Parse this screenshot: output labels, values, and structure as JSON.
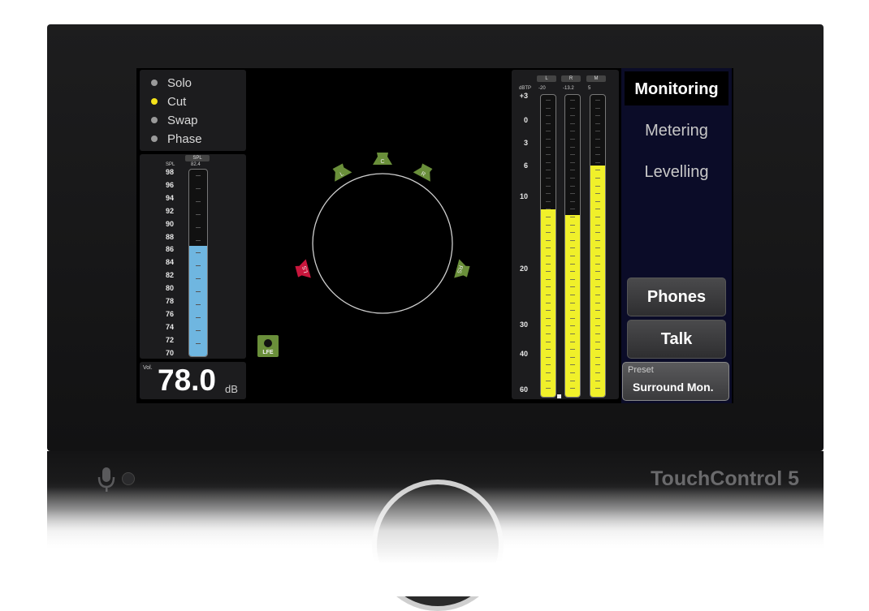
{
  "options": [
    {
      "label": "Solo",
      "active": false
    },
    {
      "label": "Cut",
      "active": true
    },
    {
      "label": "Swap",
      "active": false
    },
    {
      "label": "Phase",
      "active": false
    }
  ],
  "spl_meter": {
    "header": "SPL",
    "axis_label": "SPL",
    "readout": "82.4",
    "ticks": [
      "98",
      "96",
      "94",
      "92",
      "90",
      "88",
      "86",
      "84",
      "82",
      "80",
      "78",
      "76",
      "74",
      "72",
      "70"
    ],
    "level": 87,
    "color": "#6fb6e0"
  },
  "volume": {
    "label": "Vol.",
    "value": "78.0",
    "unit": "dB"
  },
  "speakers": {
    "L": "L",
    "C": "C",
    "R": "R",
    "LS": "LS",
    "RS": "RS",
    "LFE": "LFE",
    "active_color": "#6a8f3a",
    "muted_color": "#c8163c"
  },
  "level_meters": {
    "unit": "dBTP",
    "channels": [
      {
        "name": "L",
        "readout": "-20",
        "level_db": 11.6
      },
      {
        "name": "R",
        "readout": "-13.2",
        "level_db": 12.4
      },
      {
        "name": "M",
        "readout": "5",
        "level_db": 5.8
      }
    ],
    "scale": [
      "+3",
      "0",
      "3",
      "6",
      "10",
      "20",
      "30",
      "40",
      "60"
    ],
    "color": "#f0f02a"
  },
  "tabs": [
    {
      "label": "Monitoring",
      "active": true
    },
    {
      "label": "Metering",
      "active": false
    },
    {
      "label": "Levelling",
      "active": false
    }
  ],
  "buttons": {
    "phones": "Phones",
    "talk": "Talk"
  },
  "preset": {
    "label": "Preset",
    "value": "Surround Mon."
  },
  "brand": "TouchControl 5"
}
